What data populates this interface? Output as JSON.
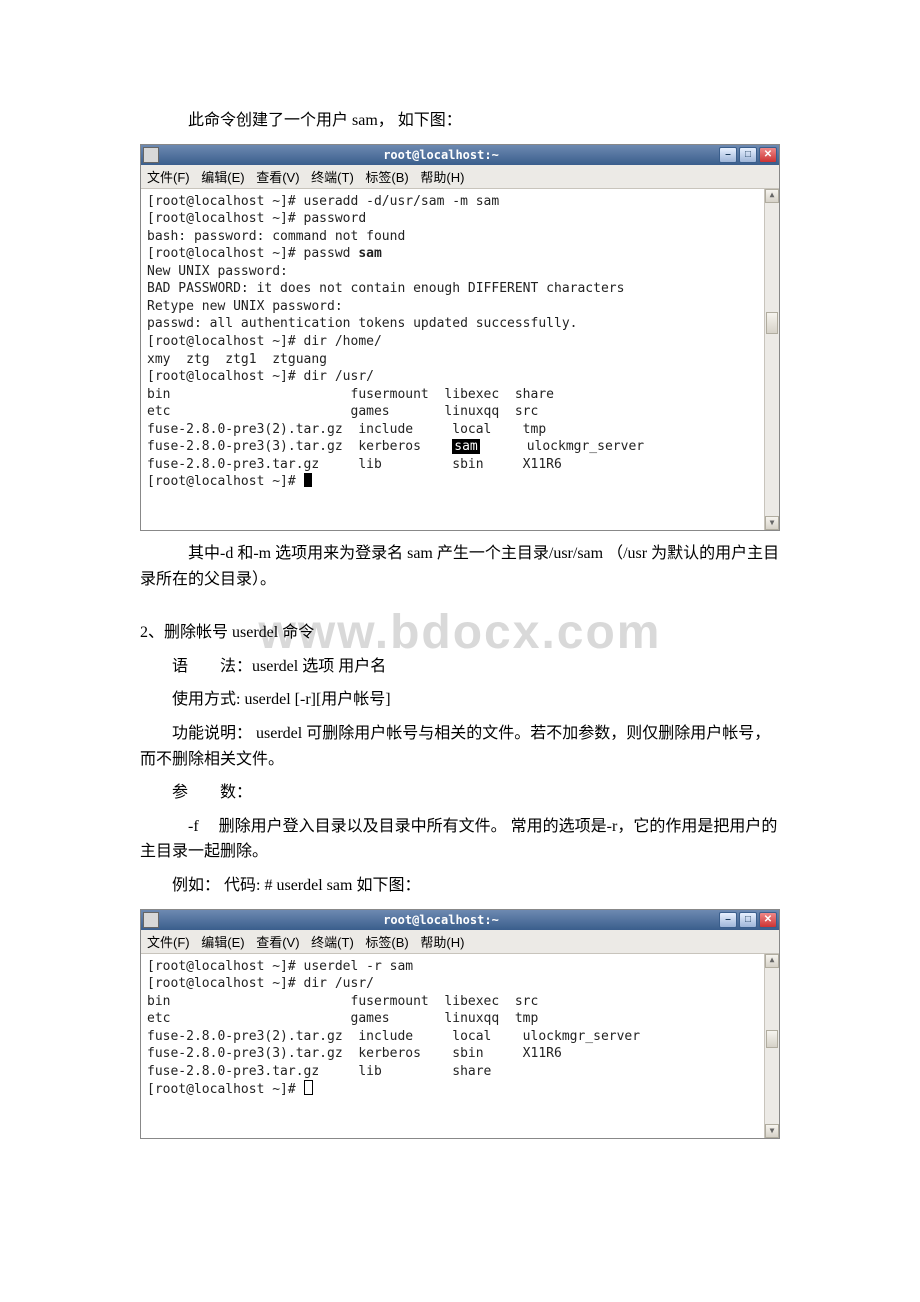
{
  "watermark": "www.bdocx.com",
  "intro1": "此命令创建了一个用户 sam， 如下图：",
  "term1": {
    "title": "root@localhost:~",
    "menu": {
      "file": "文件(F)",
      "edit": "编辑(E)",
      "view": "查看(V)",
      "terminal": "终端(T)",
      "tabs": "标签(B)",
      "help": "帮助(H)"
    },
    "lines_pre": "[root@localhost ~]# useradd -d/usr/sam -m sam\n[root@localhost ~]# password\nbash: password: command not found\n[root@localhost ~]# passwd ",
    "passwd_arg": "sam",
    "lines_mid": "\nNew UNIX password:\nBAD PASSWORD: it does not contain enough DIFFERENT characters\nRetype new UNIX password:\npasswd: all authentication tokens updated successfully.\n[root@localhost ~]# dir /home/\nxmy  ztg  ztg1  ztguang\n[root@localhost ~]# dir /usr/\nbin                       fusermount  libexec  share\netc                       games       linuxqq  src\nfuse-2.8.0-pre3(2).tar.gz  include     local    tmp\nfuse-2.8.0-pre3(3).tar.gz  kerberos    ",
    "hl": "sam",
    "lines_post": "      ulockmgr_server\nfuse-2.8.0-pre3.tar.gz     lib         sbin     X11R6\n[root@localhost ~]# "
  },
  "para2": "其中-d 和-m 选项用来为登录名 sam 产生一个主目录/usr/sam （/usr 为默认的用户主目录所在的父目录）。",
  "heading2": "2、删除帐号 userdel 命令",
  "syntax_label": "语　　法：",
  "syntax_val": "userdel 选项 用户名",
  "usage_label": "使用方式: ",
  "usage_val": "userdel [-r][用户帐号]",
  "func_label": "功能说明：",
  "func_val": " userdel 可删除用户帐号与相关的文件。若不加参数，则仅删除用户帐号，而不删除相关文件。",
  "param_label": "参　　数：",
  "param_f": "-f　 删除用户登入目录以及目录中所有文件。 常用的选项是-r，它的作用是把用户的主目录一起删除。",
  "example_label": "例如：",
  "example_val": " 代码: # userdel sam 如下图：",
  "term2": {
    "title": "root@localhost:~",
    "body": "[root@localhost ~]# userdel -r sam\n[root@localhost ~]# dir /usr/\nbin                       fusermount  libexec  src\netc                       games       linuxqq  tmp\nfuse-2.8.0-pre3(2).tar.gz  include     local    ulockmgr_server\nfuse-2.8.0-pre3(3).tar.gz  kerberos    sbin     X11R6\nfuse-2.8.0-pre3.tar.gz     lib         share\n[root@localhost ~]# "
  }
}
